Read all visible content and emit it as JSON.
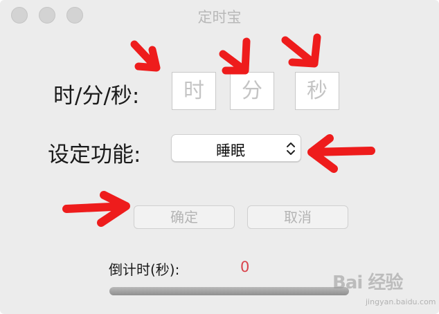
{
  "window": {
    "title": "定时宝"
  },
  "time_row": {
    "label": "时/分/秒:",
    "hour_placeholder": "时",
    "minute_placeholder": "分",
    "second_placeholder": "秒"
  },
  "function_row": {
    "label": "设定功能:",
    "selected": "睡眠"
  },
  "buttons": {
    "ok": "确定",
    "cancel": "取消"
  },
  "countdown": {
    "label": "倒计时(秒):",
    "value": "0",
    "progress_fraction": 0
  },
  "watermark": {
    "brand": "Bai 经验",
    "url": "jingyan.baidu.com"
  },
  "colors": {
    "annotation_arrow": "#ee1c1c",
    "countdown_value": "#d9434b"
  }
}
